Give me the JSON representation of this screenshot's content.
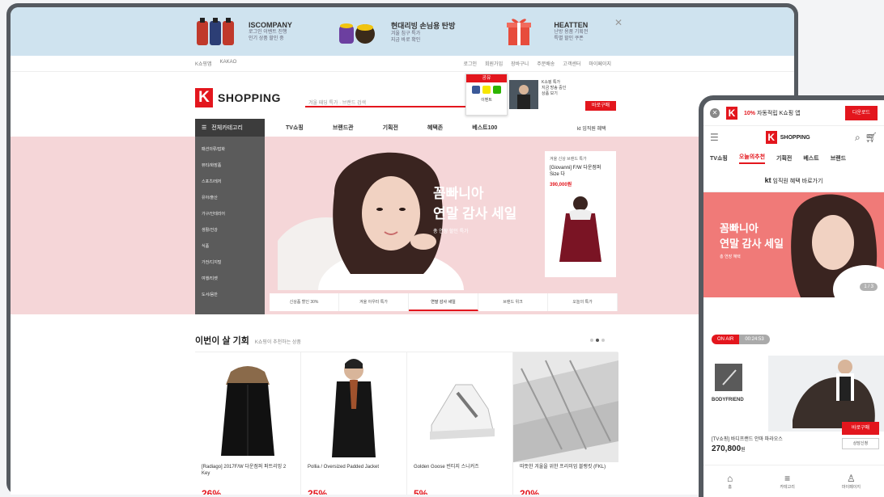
{
  "desktop": {
    "ads": [
      {
        "title": "ISCOMPANY",
        "lines": [
          "로그인 이벤트 진행",
          "인기 상품 할인 중"
        ],
        "color": "#c0392b"
      },
      {
        "title": "현대리빙 손님용 탄방",
        "lines": [
          "겨울 침구 특가",
          "지금 바로 확인"
        ],
        "color": "#8e44ad"
      },
      {
        "title": "HEATTEN",
        "lines": [
          "난방 용품 기획전",
          "특별 할인 쿠폰"
        ],
        "color": "#e74c3c"
      }
    ],
    "util_left": [
      "K쇼핑앱",
      "KAKAO"
    ],
    "util_right": [
      "로그인",
      "회원가입",
      "장바구니",
      "주문배송",
      "고객센터",
      "마이페이지"
    ],
    "logo_text": "SHOPPING",
    "search_placeholder": "겨울 패딩 특가 · 브랜드 검색",
    "popup": {
      "header": "공유",
      "footer": "이벤트"
    },
    "header_product": [
      "K쇼핑 특가",
      "지금 방송 중인",
      "상품 보기"
    ],
    "header_button": "바로구매",
    "category_button": "전체카테고리",
    "nav": [
      "TV쇼핑",
      "브랜드관",
      "기획전",
      "혜택존",
      "베스트100"
    ],
    "kt_link": "kt 임직원 혜택",
    "categories": [
      "패션의류/잡화",
      "뷰티/화장품",
      "스포츠/레저",
      "유아/출산",
      "가구/인테리어",
      "생활/건강",
      "식품",
      "가전/디지털",
      "여행/티켓",
      "도서/음반"
    ],
    "promo": {
      "line1": "꼼빠니아",
      "line2": "연말 감사 세일",
      "line3": "총 연장 할인 특가"
    },
    "product_card": {
      "small": "겨울 신상 브랜드 특가",
      "name": "[Giovanni] F/W 다운점퍼 Size 다",
      "price": "390,000원"
    },
    "subtabs": [
      "신상품 할인 30%",
      "겨울 아우터 특가",
      "연말 감사 세일",
      "브랜드 위크",
      "오늘의 특가"
    ],
    "deals_title": "이번이 살 기회",
    "deals_sub": "K쇼핑이 추천하는 상품",
    "deals": [
      {
        "name": "[Radiago] 2017F/W 다운점퍼 퍼트리밍 2 Key",
        "pct": "26%"
      },
      {
        "name": "Pollia / Oversized Padded Jacket",
        "pct": "25%"
      },
      {
        "name": "Golden Goose 빈티지 스니커즈",
        "pct": "5%"
      },
      {
        "name": "따뜻한 겨울을 위한 프리미엄 블랭킷 (FKL)",
        "pct": "20%"
      }
    ]
  },
  "mobile": {
    "promo_pct": "10%",
    "promo_text": "자동적립 K쇼핑 앱",
    "promo_button": "다운로드",
    "logo_text": "SHOPPING",
    "tabs": [
      "TV쇼핑",
      "오늘의추천",
      "기획전",
      "베스트",
      "브랜드"
    ],
    "kt_text": "임직원 혜택 바로가기",
    "hero_line1": "꼼빠니아",
    "hero_line2": "연말 감사 세일",
    "hero_line3": "총 연장 혜택",
    "hero_counter": "1 / 3",
    "onair_label": "ON AIR",
    "onair_time": "00:24:53",
    "brand_label": "BODYFRIEND",
    "product_name": "[TV쇼핑] 바디프랜드 안마 파라오스",
    "price": "270,800",
    "price_unit": "원",
    "buy_button": "바로구매",
    "sub_button": "상담신청",
    "bottom": [
      "홈",
      "카테고리",
      "마이페이지"
    ]
  },
  "colors": {
    "brand": "#e3161d",
    "adbar": "#cfe3ef",
    "hero": "#f5d6d8",
    "frame": "#555a60"
  }
}
